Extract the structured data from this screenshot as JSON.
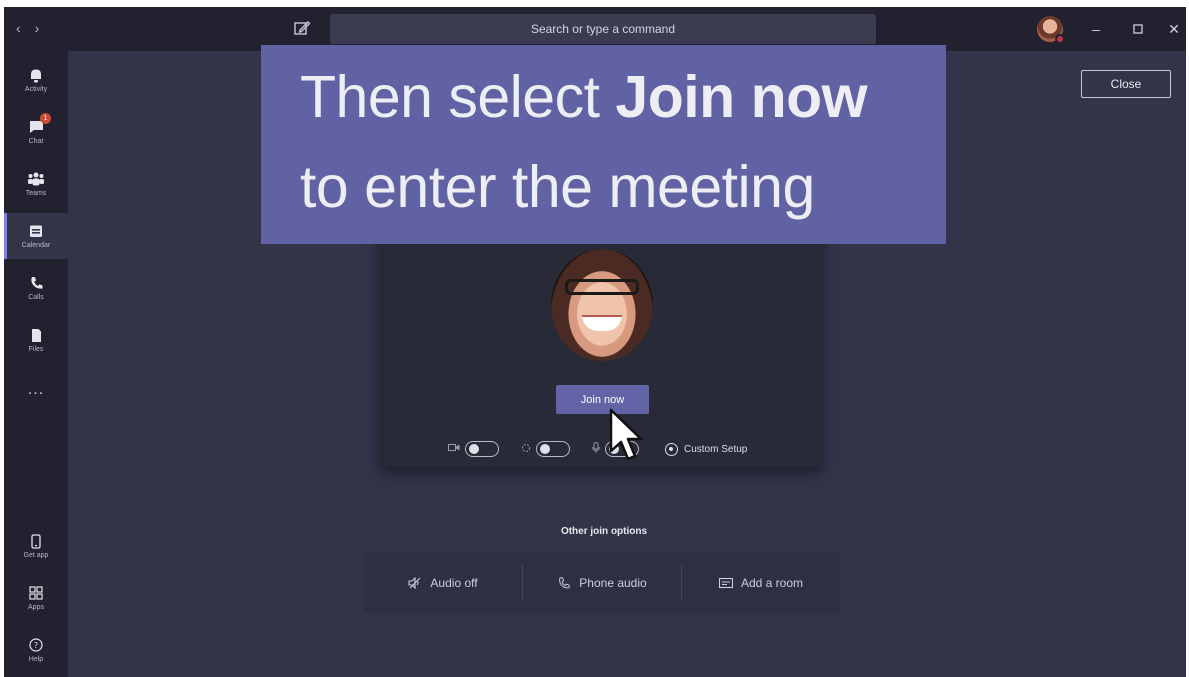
{
  "titlebar": {
    "nav_icons": [
      "chevron-left-icon",
      "chevron-right-icon"
    ],
    "search_placeholder": "Search or type a command",
    "window_controls": [
      "minimize-icon",
      "maximize-icon",
      "close-icon"
    ]
  },
  "rail": {
    "items": [
      {
        "label": "Activity",
        "icon": "bell-icon"
      },
      {
        "label": "Chat",
        "icon": "chat-icon",
        "badge": "1"
      },
      {
        "label": "Teams",
        "icon": "teams-icon"
      },
      {
        "label": "Calendar",
        "icon": "calendar-icon",
        "active": true
      },
      {
        "label": "Calls",
        "icon": "phone-icon"
      },
      {
        "label": "Files",
        "icon": "file-icon"
      }
    ],
    "more": "...",
    "bottom_items": [
      {
        "label": "Get app",
        "icon": "mobile-icon"
      },
      {
        "label": "Apps",
        "icon": "apps-icon"
      },
      {
        "label": "Help",
        "icon": "help-icon"
      }
    ]
  },
  "close_label": "Close",
  "banner": {
    "line1_prefix": "Then select ",
    "line1_bold": "Join now",
    "line2": "to enter the meeting"
  },
  "prejoin": {
    "join_label": "Join now",
    "custom_setup": "Custom Setup"
  },
  "other_join": {
    "title": "Other join options",
    "options": [
      {
        "label": "Audio off",
        "icon": "audio-off-icon"
      },
      {
        "label": "Phone audio",
        "icon": "phone-icon"
      },
      {
        "label": "Add a room",
        "icon": "room-icon"
      }
    ]
  },
  "colors": {
    "accent": "#6264a7",
    "background": "#33344a",
    "rail": "#212130",
    "badge": "#cc4a31"
  }
}
